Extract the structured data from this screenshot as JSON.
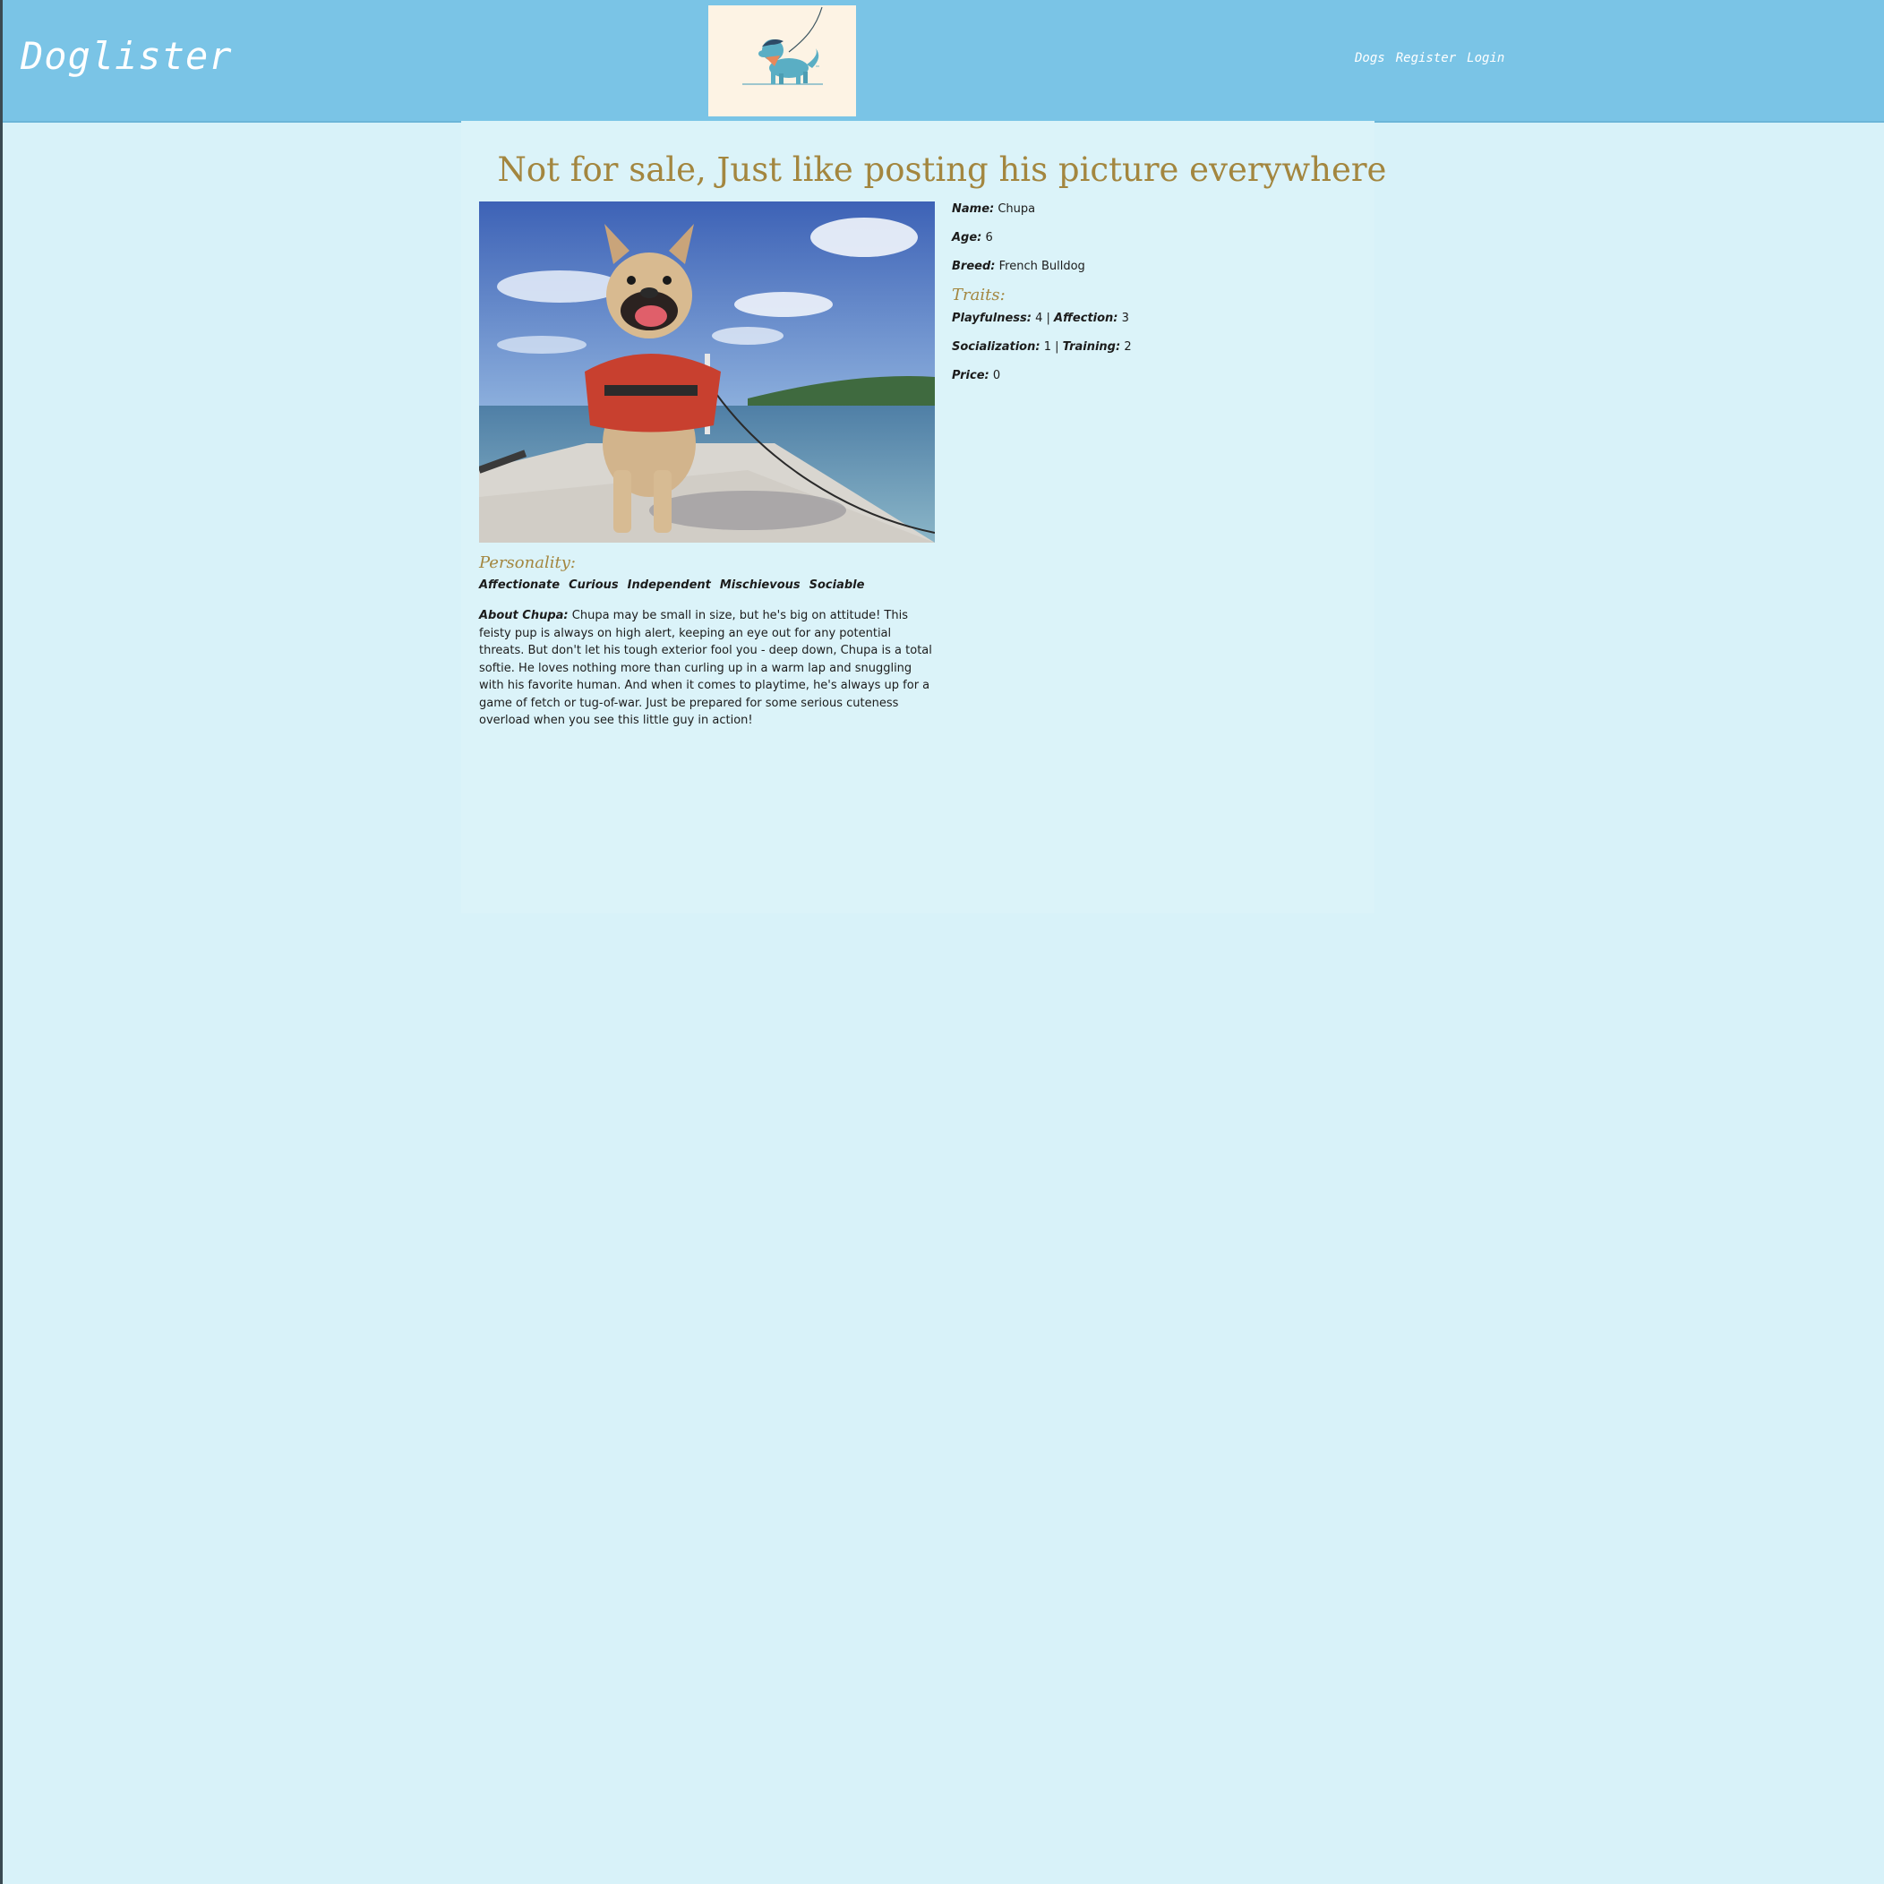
{
  "header": {
    "brand": "Doglister",
    "nav": [
      "Dogs",
      "Register",
      "Login"
    ]
  },
  "logo": {
    "icon": "dog-on-leash-illustration"
  },
  "page_title": "Not for sale, Just like posting his picture everywhere",
  "photo": {
    "subject": "french-bulldog-on-dock-photo"
  },
  "details": {
    "name_label": "Name:",
    "name_value": "Chupa",
    "age_label": "Age:",
    "age_value": "6",
    "breed_label": "Breed:",
    "breed_value": "French Bulldog",
    "traits_title": "Traits:",
    "playfulness_label": "Playfulness:",
    "playfulness_value": "4",
    "separator": "|",
    "affection_label": "Affection:",
    "affection_value": "3",
    "socialization_label": "Socialization:",
    "socialization_value": "1",
    "training_label": "Training:",
    "training_value": "2",
    "price_label": "Price:",
    "price_value": "0"
  },
  "personality": {
    "title": "Personality:",
    "tags": [
      "Affectionate",
      "Curious",
      "Independent",
      "Mischievous",
      "Sociable"
    ]
  },
  "about": {
    "label": "About Chupa:",
    "text": "Chupa may be small in size, but he's big on attitude! This feisty pup is always on high alert, keeping an eye out for any potential threats. But don't let his tough exterior fool you - deep down, Chupa is a total softie. He loves nothing more than curling up in a warm lap and snuggling with his favorite human. And when it comes to playtime, he's always up for a game of fetch or tug-of-war. Just be prepared for some serious cuteness overload when you see this little guy in action!"
  },
  "colors": {
    "header_bg": "#7ac4e6",
    "page_bg": "#d8f2f9",
    "accent_gold": "#a3863f"
  }
}
